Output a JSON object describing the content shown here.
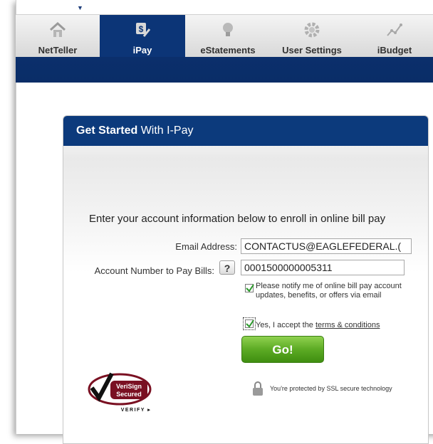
{
  "nav": {
    "tabs": [
      {
        "label": "NetTeller",
        "icon": "house-icon"
      },
      {
        "label": "iPay",
        "icon": "money-pen-icon",
        "active": true
      },
      {
        "label": "eStatements",
        "icon": "lightbulb-icon"
      },
      {
        "label": "User Settings",
        "icon": "gear-icon"
      },
      {
        "label": "iBudget",
        "icon": "trend-line-icon"
      }
    ]
  },
  "panel": {
    "title_bold": "Get Started",
    "title_rest": " With I-Pay",
    "intro": "Enter your account information below to enroll in online bill pay"
  },
  "form": {
    "email_label": "Email Address:",
    "email_value": "CONTACTUS@EAGLEFEDERAL.(",
    "account_label": "Account Number to Pay Bills:",
    "help_label": "?",
    "account_value": "0001500000005311",
    "notify_text": "Please notify me of online bill pay account updates, benefits, or offers via email",
    "accept_prefix": "Yes, I accept the ",
    "accept_link": "terms & conditions",
    "go_label": "Go!"
  },
  "security": {
    "ssl_text": "You're protected by SSL secure technology",
    "verisign_line1": "VeriSign",
    "verisign_line2": "Secured",
    "verisign_verify": "VERIFY ▸"
  },
  "colors": {
    "nav_active": "#0c3577",
    "header_blue": "#0c3a7c",
    "go_green": "#5cab24"
  }
}
